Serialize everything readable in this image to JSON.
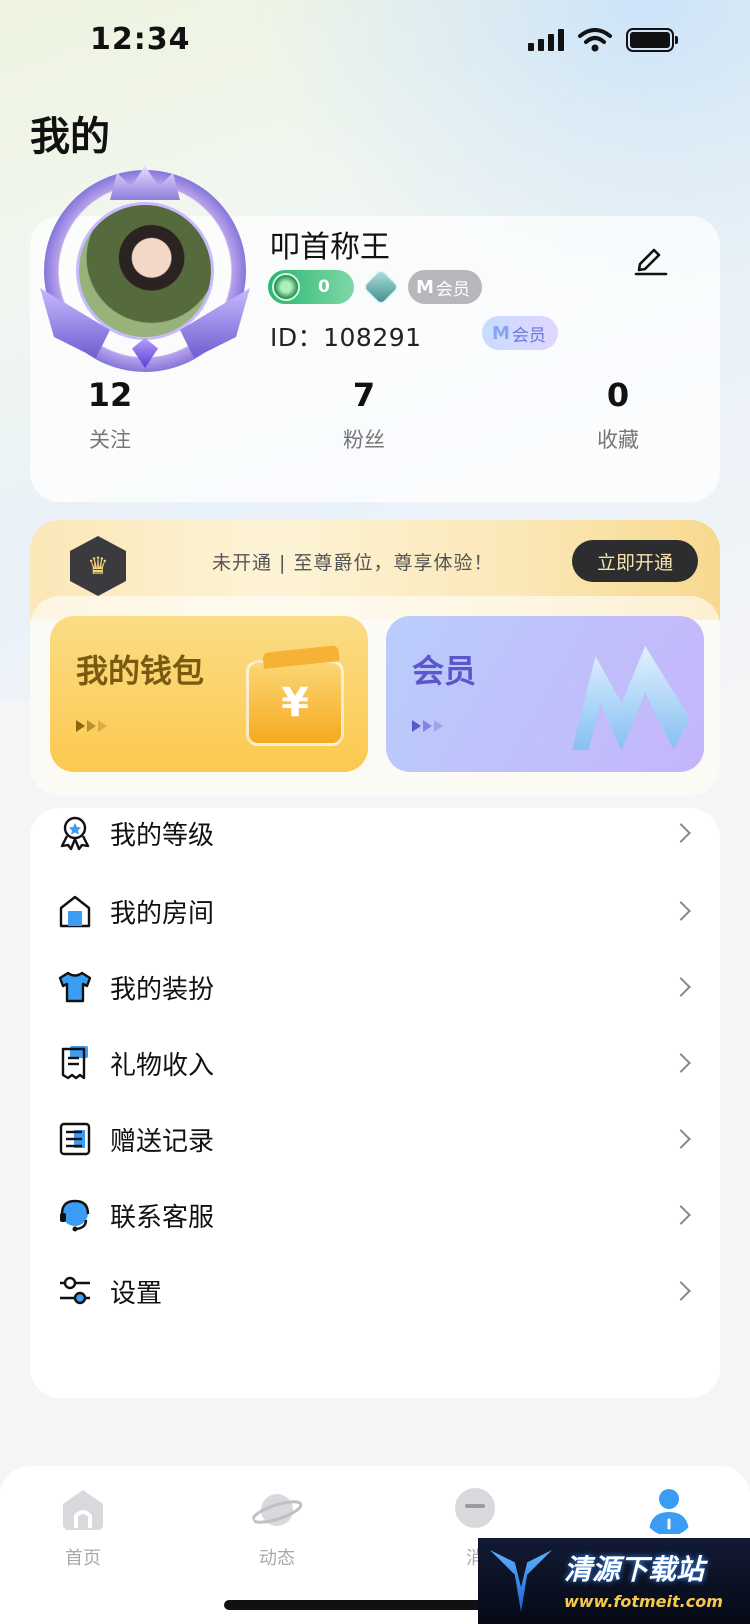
{
  "status_bar": {
    "time": "12:34"
  },
  "page_title": "我的",
  "profile": {
    "nickname": "叩首称王",
    "level_value": "0",
    "vip_badge_label": "会员",
    "vip_badge_mark": "M",
    "id_text": "ID：108291",
    "vip_tag_label": "会员",
    "vip_tag_mark": "M",
    "stats": [
      {
        "value": "12",
        "label": "关注"
      },
      {
        "value": "7",
        "label": "粉丝"
      },
      {
        "value": "0",
        "label": "收藏"
      }
    ]
  },
  "noble": {
    "crown_glyph": "♛",
    "promo_text": "未开通 | 至尊爵位，尊享体验！",
    "open_button": "立即开通"
  },
  "tiles": {
    "wallet": {
      "title": "我的钱包",
      "icon_glyph": "¥"
    },
    "vip": {
      "title": "会员"
    }
  },
  "menu": [
    {
      "label": "我的等级",
      "icon": "medal-icon"
    },
    {
      "label": "我的房间",
      "icon": "room-icon"
    },
    {
      "label": "我的装扮",
      "icon": "shirt-icon"
    },
    {
      "label": "礼物收入",
      "icon": "receipt-icon"
    },
    {
      "label": "赠送记录",
      "icon": "record-icon"
    },
    {
      "label": "联系客服",
      "icon": "headset-icon"
    },
    {
      "label": "设置",
      "icon": "settings-icon"
    }
  ],
  "tab_bar": [
    {
      "label": "首页",
      "icon": "home-icon"
    },
    {
      "label": "动态",
      "icon": "planet-icon"
    },
    {
      "label": "消",
      "icon": "message-icon"
    },
    {
      "label": "",
      "icon": "profile-icon",
      "active": true
    }
  ],
  "watermark": {
    "title": "清源下载站",
    "url": "www.fotmeit.com"
  },
  "colors": {
    "accent_blue": "#3a9cf2",
    "gold": "#fcc94f",
    "violet": "#5b56c9"
  }
}
